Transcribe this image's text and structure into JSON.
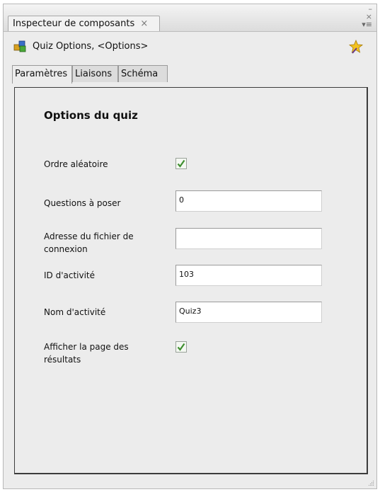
{
  "panel": {
    "doc_tab_label": "Inspecteur de composants",
    "close_glyph": "×",
    "minimize_glyph": "–",
    "close_panel_glyph": "×",
    "menu_glyph": "▾≡"
  },
  "component": {
    "title": "Quiz Options, <Options>",
    "icon": "component-cubes-icon",
    "action_icon": "star-wand-icon"
  },
  "tabs": [
    {
      "label": "Paramètres",
      "active": true
    },
    {
      "label": "Liaisons",
      "active": false
    },
    {
      "label": "Schéma",
      "active": false
    }
  ],
  "form": {
    "title": "Options du quiz",
    "random_order": {
      "label": "Ordre aléatoire",
      "checked": true
    },
    "questions": {
      "label": "Questions à poser",
      "value": "0"
    },
    "login_file": {
      "label": "Adresse du fichier de connexion",
      "value": ""
    },
    "activity_id": {
      "label": "ID d'activité",
      "value": "103"
    },
    "activity_name": {
      "label": "Nom d'activité",
      "value": "Quiz3"
    },
    "show_results": {
      "label": "Afficher la page des résultats",
      "checked": true
    }
  },
  "colors": {
    "check": "#3f8f2f",
    "panel_bg": "#ececec"
  }
}
